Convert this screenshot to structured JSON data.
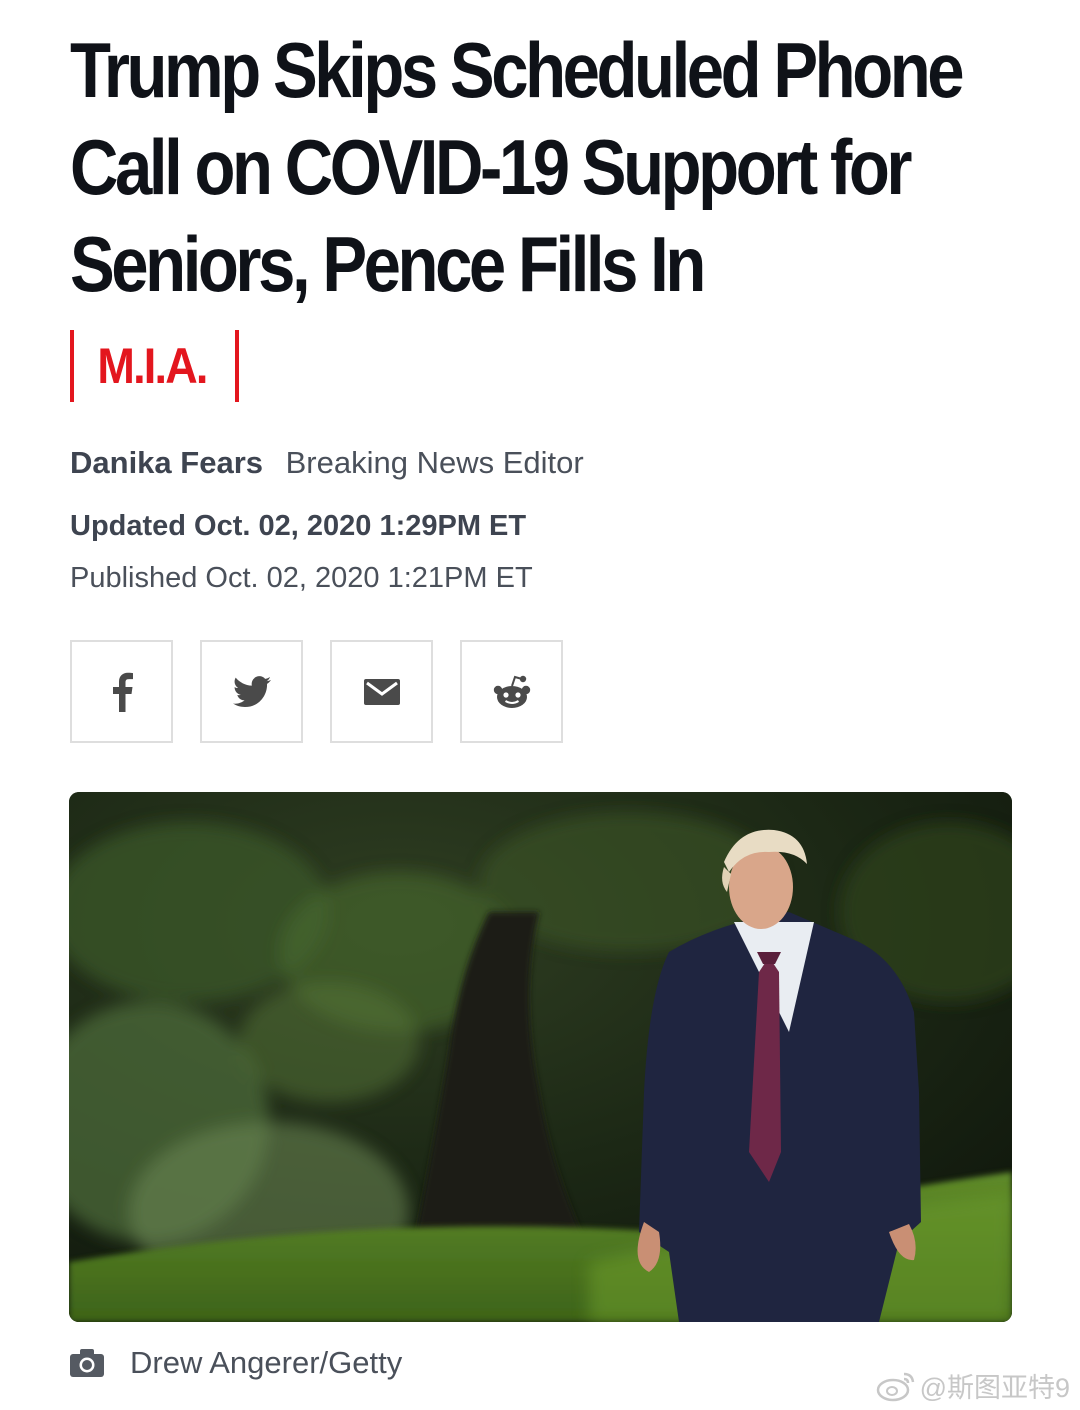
{
  "article": {
    "headline": "Trump Skips Scheduled Phone Call on COVID-19 Support for Seniors, Pence Fills In",
    "tag": "M.I.A.",
    "author": "Danika Fears",
    "author_role": "Breaking News Editor",
    "updated": "Updated Oct. 02, 2020 1:29PM ET",
    "published": "Published Oct. 02, 2020 1:21PM ET",
    "photo_credit": "Drew Angerer/Getty"
  },
  "share": {
    "buttons": [
      {
        "icon": "facebook-icon"
      },
      {
        "icon": "twitter-icon"
      },
      {
        "icon": "email-icon"
      },
      {
        "icon": "reddit-icon"
      }
    ],
    "icon_color": "#4a4a4a"
  },
  "watermark": {
    "text": "@斯图亚特9"
  },
  "colors": {
    "accent": "#e3161e",
    "headline": "#0f1218",
    "meta": "#3e4450"
  }
}
